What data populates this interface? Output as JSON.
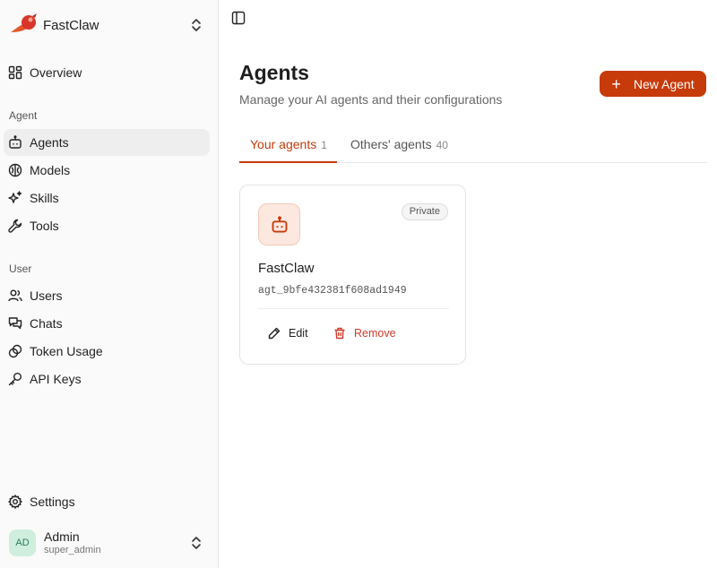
{
  "brand": {
    "name": "FastClaw",
    "logo_icon": "rocket-logo"
  },
  "nav": {
    "overview": "Overview",
    "section_agent": "Agent",
    "agents": "Agents",
    "models": "Models",
    "skills": "Skills",
    "tools": "Tools",
    "section_user": "User",
    "users": "Users",
    "chats": "Chats",
    "token_usage": "Token Usage",
    "api_keys": "API Keys",
    "settings": "Settings"
  },
  "user": {
    "initials": "AD",
    "name": "Admin",
    "role": "super_admin"
  },
  "page": {
    "title": "Agents",
    "subtitle": "Manage your AI agents and their configurations",
    "new_button": "New Agent",
    "new_button_icon": "+"
  },
  "tabs": [
    {
      "label": "Your agents",
      "count": "1",
      "active": true
    },
    {
      "label": "Others' agents",
      "count": "40",
      "active": false
    }
  ],
  "agent_card": {
    "name": "FastClaw",
    "id": "agt_9bfe432381f608ad1949",
    "badge": "Private",
    "edit_label": "Edit",
    "remove_label": "Remove",
    "icon": "bot-icon"
  },
  "colors": {
    "accent": "#c73a0a",
    "danger": "#d23a2a",
    "sidebar_bg": "#fafafa",
    "active_item_bg": "#eeeeee"
  }
}
